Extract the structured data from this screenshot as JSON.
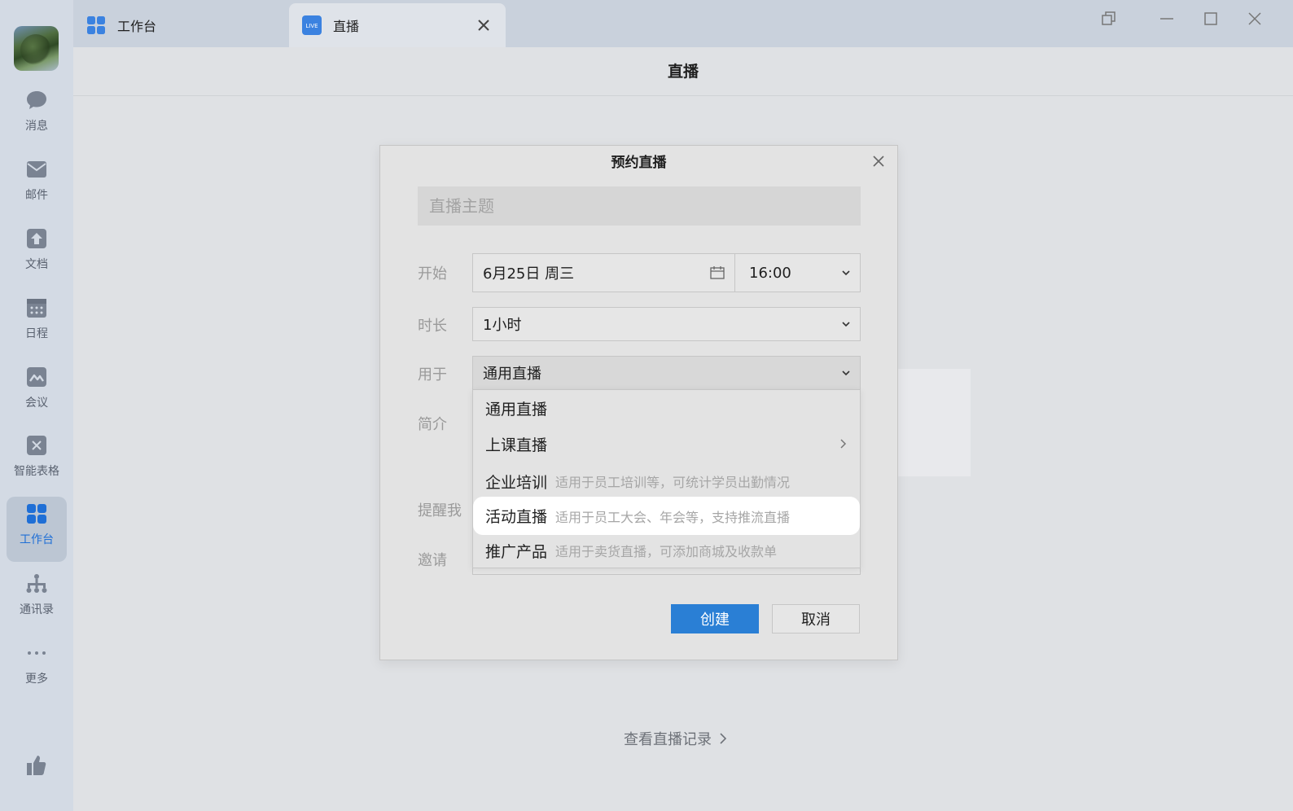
{
  "sidebar": {
    "items": [
      {
        "label": "消息",
        "icon": "chat-bubble-icon"
      },
      {
        "label": "邮件",
        "icon": "mail-icon"
      },
      {
        "label": "文档",
        "icon": "document-icon"
      },
      {
        "label": "日程",
        "icon": "calendar-icon"
      },
      {
        "label": "会议",
        "icon": "meeting-icon"
      },
      {
        "label": "智能表格",
        "icon": "smart-sheet-icon"
      },
      {
        "label": "工作台",
        "icon": "workbench-icon",
        "active": true
      },
      {
        "label": "通讯录",
        "icon": "contacts-icon"
      },
      {
        "label": "更多",
        "icon": "more-icon"
      }
    ],
    "bottom_icon": "thumbs-up-icon"
  },
  "tabs": [
    {
      "label": "工作台",
      "icon": "workbench-icon"
    },
    {
      "label": "直播",
      "icon": "live-icon",
      "icon_text": "LIVE",
      "active": true
    }
  ],
  "page": {
    "title": "直播",
    "history_link": "查看直播记录"
  },
  "dialog": {
    "title": "预约直播",
    "topic_placeholder": "直播主题",
    "start_label": "开始",
    "start_date": "6月25日 周三",
    "start_time": "16:00",
    "duration_label": "时长",
    "duration_value": "1小时",
    "usage_label": "用于",
    "usage_value": "通用直播",
    "intro_label": "简介",
    "remind_label": "提醒我",
    "invite_label": "邀请",
    "create_button": "创建",
    "cancel_button": "取消"
  },
  "dropdown": {
    "options": [
      {
        "label": "通用直播",
        "desc": ""
      },
      {
        "label": "上课直播",
        "desc": "",
        "has_submenu": true
      },
      {
        "label": "企业培训",
        "desc": "适用于员工培训等，可统计学员出勤情况"
      },
      {
        "label": "活动直播",
        "desc": "适用于员工大会、年会等，支持推流直播",
        "hovered": true
      },
      {
        "label": "推广产品",
        "desc": "适用于卖货直播，可添加商城及收款单"
      }
    ]
  },
  "colors": {
    "accent": "#2a7fd5",
    "live_badge": "#3b82e0"
  }
}
